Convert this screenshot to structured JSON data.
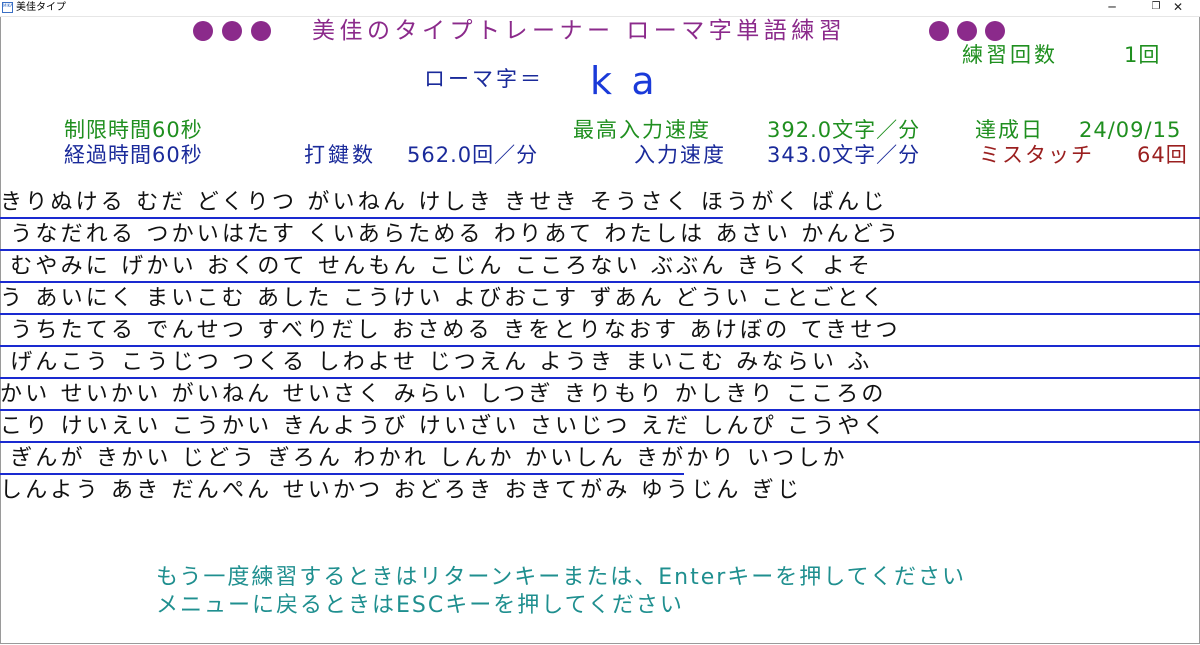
{
  "window": {
    "title": "美佳タイプ",
    "icon_label": "MIKA",
    "controls": {
      "minimize": "─",
      "maximize": "❐",
      "close": "✕"
    }
  },
  "header": {
    "title": "美佳のタイプトレーナー ローマ字単語練習",
    "dot_color": "#8b2a8b",
    "practice_count_label": "練習回数",
    "practice_count_value": "1回"
  },
  "romaji": {
    "label": "ローマ字＝",
    "value": "ka"
  },
  "stats": {
    "time_limit": "制限時間60秒",
    "elapsed_time": "経過時間60秒",
    "keystrokes_label": "打鍵数",
    "keystrokes_value": "562.0回／分",
    "best_speed_label": "最高入力速度",
    "best_speed_value": "392.0文字／分",
    "achieved_date_label": "達成日",
    "achieved_date_value": "24/09/15",
    "speed_label": "入力速度",
    "speed_value": "343.0文字／分",
    "mistouch_label": "ミスタッチ",
    "mistouch_value": "64回"
  },
  "words": {
    "lines": [
      "きりぬける むだ どくりつ がいねん けしき きせき そうさく ほうがく ばんじ",
      " うなだれる つかいはたす くいあらためる わりあて わたしは あさい かんどう",
      " むやみに げかい おくのて せんもん こじん こころない ぶぶん きらく よそ",
      "う あいにく まいこむ あした こうけい よびおこす ずあん どうい ことごとく",
      " うちたてる でんせつ すべりだし おさめる きをとりなおす あけぼの てきせつ",
      " げんこう こうじつ つくる しわよせ じつえん ようき まいこむ みならい ふ",
      "かい せいかい がいねん せいさく みらい しつぎ きりもり かしきり こころの",
      "こり けいえい こうかい きんようび けいざい さいじつ えだ しんぴ こうやく",
      " ぎんが きかい じどう ぎろん わかれ しんか かいしん きがかり いつしか",
      "しんよう あき だんぺん せいかつ おどろき おきてがみ ゆうじん ぎじ"
    ],
    "typed_progress_last_line": 0.57,
    "underline_color": "#1a2ad0"
  },
  "footer": {
    "line1": "もう一度練習するときはリターンキーまたは、Enterキーを押してください",
    "line2": "メニューに戻るときはESCキーを押してください"
  }
}
